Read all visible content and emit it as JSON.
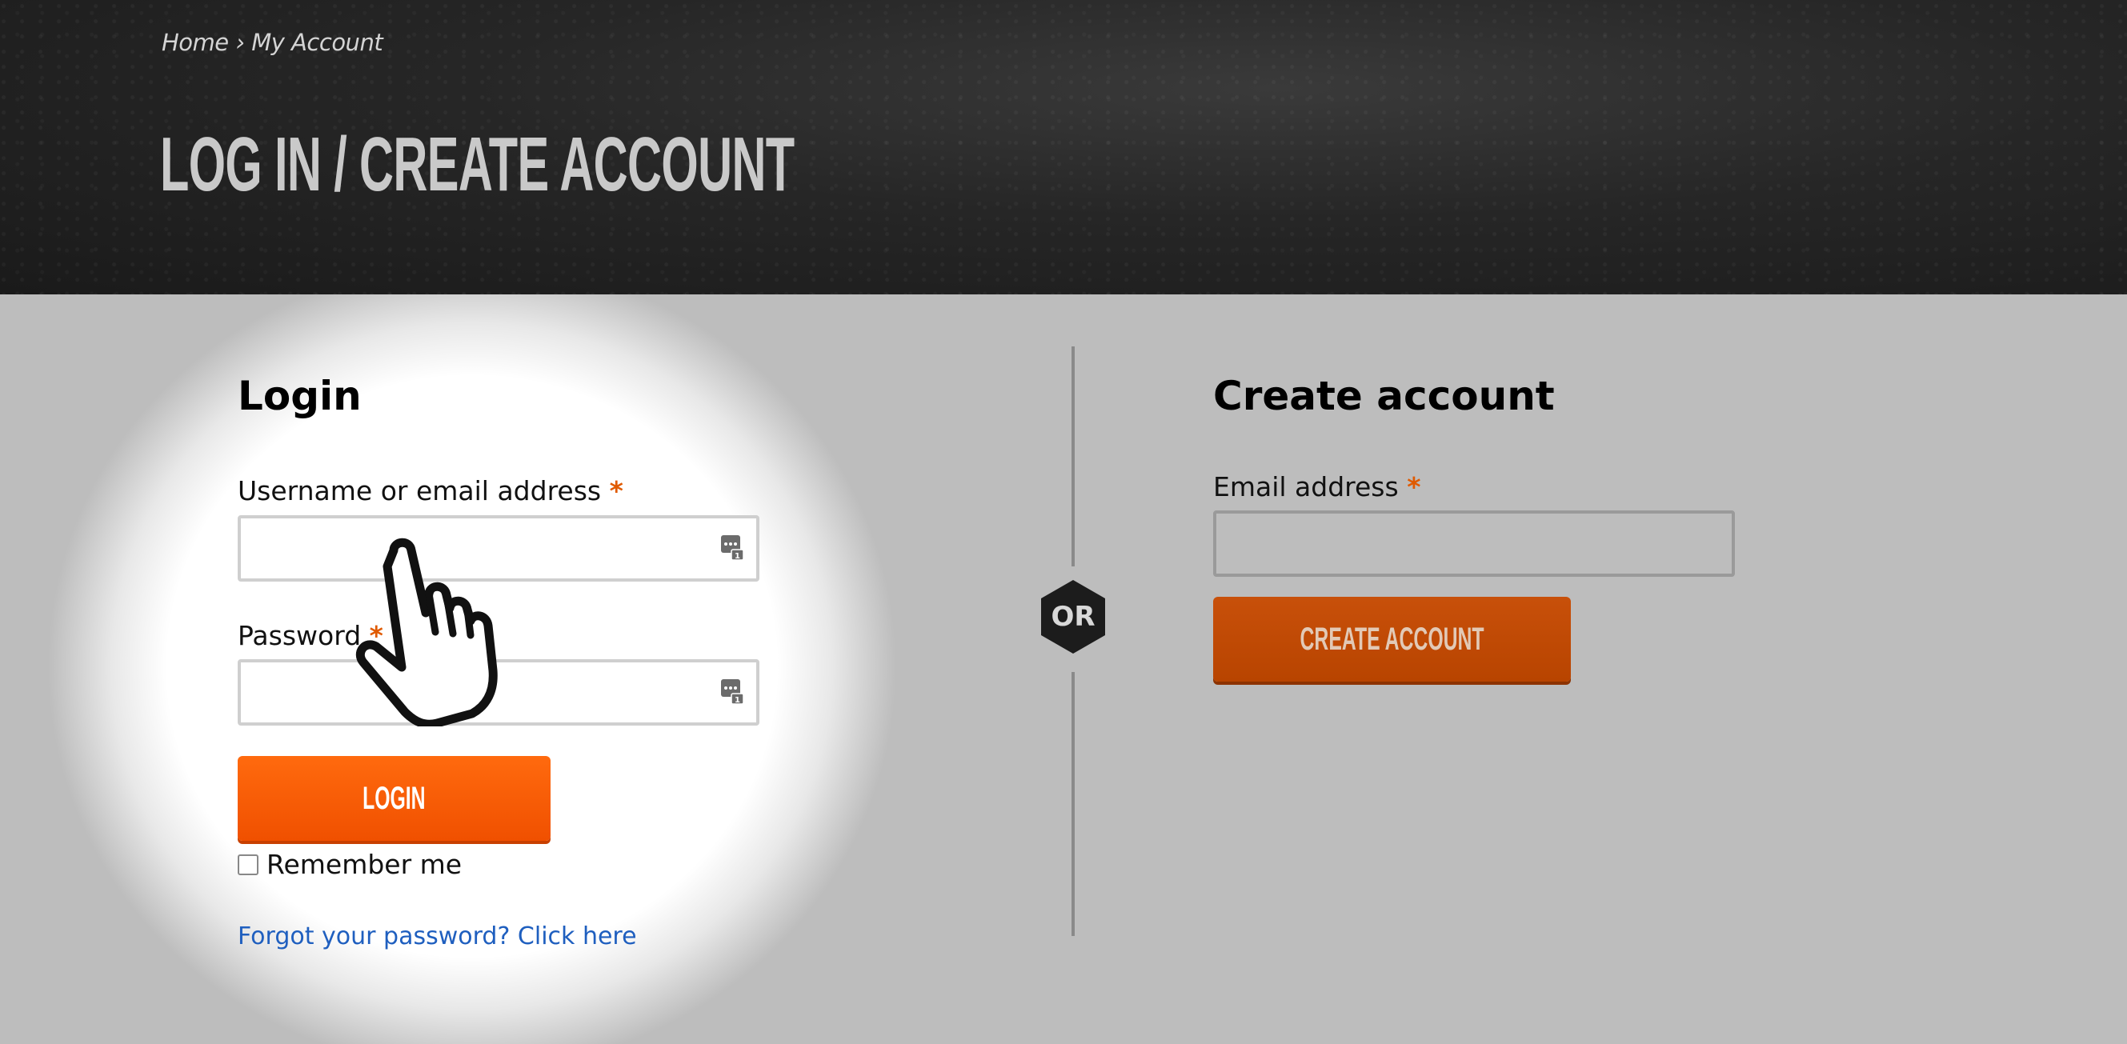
{
  "breadcrumb": {
    "home": "Home",
    "separator": "›",
    "current": "My Account"
  },
  "page_title": "LOG IN / CREATE ACCOUNT",
  "login": {
    "title": "Login",
    "username_label": "Username or email address",
    "password_label": "Password",
    "required_marker": "*",
    "username_value": "",
    "password_value": "",
    "submit_label": "LOGIN",
    "remember_label": "Remember me",
    "remember_checked": false,
    "forgot_link": "Forgot your password? Click here",
    "field_icon": "password-manager-key-icon"
  },
  "separator": {
    "label": "OR"
  },
  "register": {
    "title": "Create account",
    "email_label": "Email address",
    "required_marker": "*",
    "email_value": "",
    "submit_label": "CREATE ACCOUNT"
  },
  "overlay": {
    "cursor_icon": "pointing-hand-cursor-icon"
  },
  "colors": {
    "accent_orange": "#ff6a0e",
    "required": "#e05a00",
    "link": "#1f5fbf",
    "header_bg": "#1f1f1f",
    "body_bg": "#bdbdbd"
  }
}
